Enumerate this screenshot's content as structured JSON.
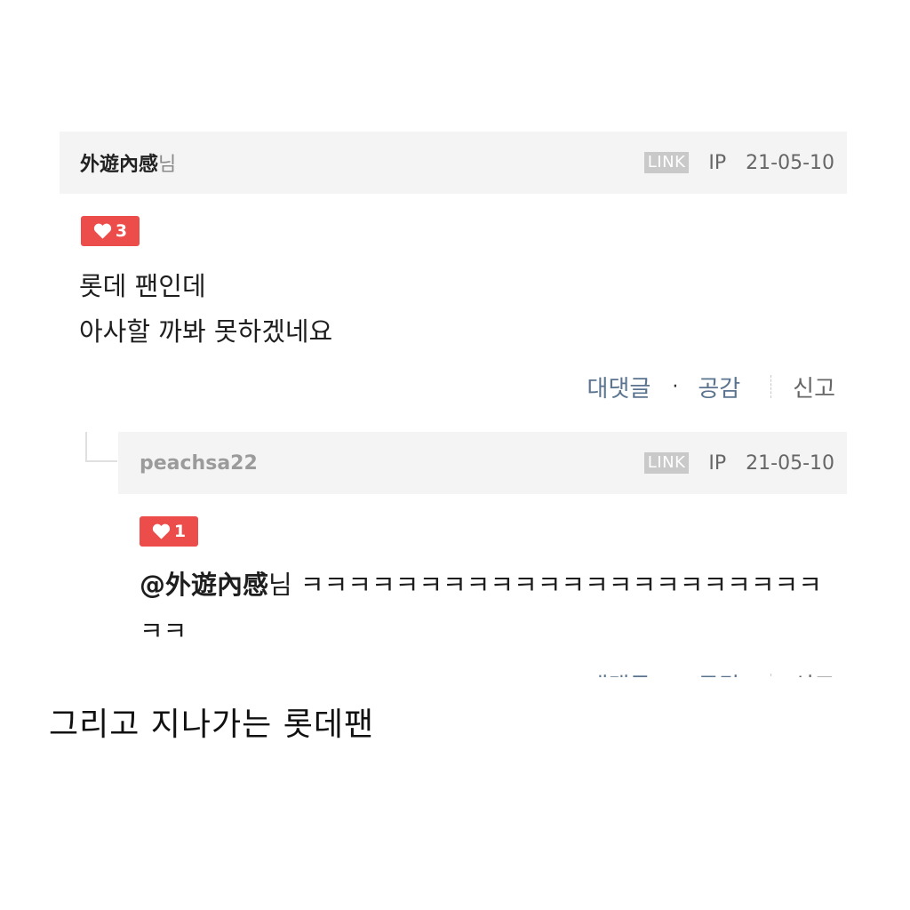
{
  "comments": [
    {
      "author": "外遊內感",
      "honorific": "님",
      "link_label": "LINK",
      "ip_label": "IP",
      "date": "21-05-10",
      "likes": "3",
      "lines": [
        "롯데 팬인데",
        "아사할 까봐 못하겠네요"
      ],
      "actions": {
        "reply": "대댓글",
        "dot": "·",
        "like": "공감",
        "report": "신고"
      }
    },
    {
      "author": "peachsa22",
      "link_label": "LINK",
      "ip_label": "IP",
      "date": "21-05-10",
      "likes": "1",
      "mention": "@外遊內感",
      "mention_suffix": "님",
      "text": " ㅋㅋㅋㅋㅋㅋㅋㅋㅋㅋㅋㅋㅋㅋㅋㅋㅋㅋㅋㅋㅋㅋㅋㅋ",
      "actions": {
        "reply": "대댓글",
        "dot": "·",
        "like": "공감",
        "report": "신고"
      }
    }
  ],
  "caption": "그리고 지나가는 롯데팬",
  "colors": {
    "header_bg": "#f4f4f4",
    "like_badge": "#ec4d4b",
    "link_badge": "#c9c9c9",
    "action_text": "#5a748f"
  },
  "icons": {
    "like": "heart-icon"
  }
}
